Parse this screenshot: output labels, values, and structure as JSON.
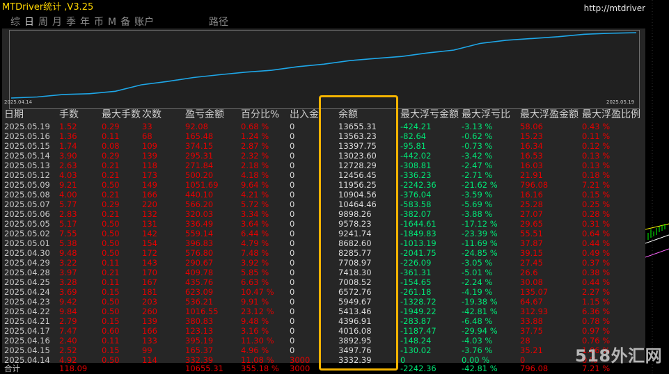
{
  "window": {
    "title": "MTDriver统计 ,V3.25",
    "url": "http://mtdriver.cn"
  },
  "tabs": [
    {
      "label": "综"
    },
    {
      "label": "日"
    },
    {
      "label": "周"
    },
    {
      "label": "月"
    },
    {
      "label": "季"
    },
    {
      "label": "年"
    },
    {
      "label": "币"
    },
    {
      "label": "M"
    },
    {
      "label": "备"
    },
    {
      "label": "账户"
    }
  ],
  "active_tab": 1,
  "path_label": "路径",
  "chart": {
    "type": "line",
    "start_label": "2025.04.14",
    "end_label": "2025.05.19",
    "line_color": "#1ea7e8",
    "series_balance": [
      3332.39,
      3497.76,
      3892.95,
      4016.08,
      4396.91,
      5413.46,
      5949.67,
      6572.76,
      7008.52,
      7418.3,
      7708.97,
      8285.77,
      8682.6,
      9241.74,
      9578.23,
      9898.26,
      10464.46,
      10904.56,
      11956.25,
      12456.45,
      12728.29,
      13023.6,
      13397.75,
      13563.23,
      13655.31
    ]
  },
  "table": {
    "headers": [
      "日期",
      "手数",
      "最大手数",
      "次数",
      "盈亏金额",
      "百分比%",
      "出入金",
      "余额",
      "最大浮亏金额",
      "最大浮亏比",
      "最大浮盈金额",
      "最大浮盈比例"
    ],
    "rows": [
      [
        "2025.05.19",
        "1.52",
        "0.29",
        "33",
        "92.08",
        "0.68 %",
        "0",
        "13655.31",
        "-424.21",
        "-3.13 %",
        "58.06",
        "0.43 %"
      ],
      [
        "2025.05.16",
        "1.36",
        "0.11",
        "68",
        "165.48",
        "1.24 %",
        "0",
        "13563.23",
        "-82.64",
        "-0.62 %",
        "15.23",
        "0.11 %"
      ],
      [
        "2025.05.15",
        "1.74",
        "0.08",
        "109",
        "374.15",
        "2.87 %",
        "0",
        "13397.75",
        "-95.81",
        "-0.73 %",
        "16.34",
        "0.12 %"
      ],
      [
        "2025.05.14",
        "3.90",
        "0.29",
        "139",
        "295.31",
        "2.32 %",
        "0",
        "13023.60",
        "-442.02",
        "-3.42 %",
        "16.53",
        "0.13 %"
      ],
      [
        "2025.05.13",
        "2.63",
        "0.21",
        "118",
        "271.84",
        "2.18 %",
        "0",
        "12728.29",
        "-308.81",
        "-2.47 %",
        "16.03",
        "0.13 %"
      ],
      [
        "2025.05.12",
        "4.03",
        "0.21",
        "173",
        "500.20",
        "4.18 %",
        "0",
        "12456.45",
        "-336.23",
        "-2.71 %",
        "21.91",
        "0.18 %"
      ],
      [
        "2025.05.09",
        "9.21",
        "0.50",
        "149",
        "1051.69",
        "9.64 %",
        "0",
        "11956.25",
        "-2242.36",
        "-21.62 %",
        "796.08",
        "7.21 %"
      ],
      [
        "2025.05.08",
        "4.00",
        "0.21",
        "166",
        "440.10",
        "4.21 %",
        "0",
        "10904.56",
        "-376.04",
        "-3.59 %",
        "16.16",
        "0.15 %"
      ],
      [
        "2025.05.07",
        "5.77",
        "0.29",
        "220",
        "566.20",
        "5.72 %",
        "0",
        "10464.46",
        "-583.58",
        "-5.69 %",
        "25.28",
        "0.25 %"
      ],
      [
        "2025.05.06",
        "2.83",
        "0.21",
        "132",
        "320.03",
        "3.34 %",
        "0",
        "9898.26",
        "-382.07",
        "-3.88 %",
        "27.07",
        "0.28 %"
      ],
      [
        "2025.05.05",
        "5.17",
        "0.50",
        "131",
        "336.49",
        "3.64 %",
        "0",
        "9578.23",
        "-1644.61",
        "-17.12 %",
        "29.65",
        "0.31 %"
      ],
      [
        "2025.05.02",
        "7.55",
        "0.50",
        "142",
        "559.14",
        "6.44 %",
        "0",
        "9241.74",
        "-1849.83",
        "-23.39 %",
        "55.51",
        "0.64 %"
      ],
      [
        "2025.05.01",
        "5.38",
        "0.50",
        "154",
        "396.83",
        "4.79 %",
        "0",
        "8682.60",
        "-1013.19",
        "-11.69 %",
        "37.87",
        "0.44 %"
      ],
      [
        "2025.04.30",
        "9.48",
        "0.50",
        "172",
        "576.80",
        "7.48 %",
        "0",
        "8285.77",
        "-2041.75",
        "-24.85 %",
        "39.15",
        "0.49 %"
      ],
      [
        "2025.04.29",
        "3.22",
        "0.11",
        "143",
        "290.67",
        "3.92 %",
        "0",
        "7708.97",
        "-226.09",
        "-3.05 %",
        "27.45",
        "0.37 %"
      ],
      [
        "2025.04.28",
        "3.97",
        "0.21",
        "170",
        "409.78",
        "5.85 %",
        "0",
        "7418.30",
        "-361.31",
        "-5.01 %",
        "26.6",
        "0.38 %"
      ],
      [
        "2025.04.25",
        "3.28",
        "0.11",
        "167",
        "435.76",
        "6.63 %",
        "0",
        "7008.52",
        "-154.65",
        "-2.24 %",
        "30.08",
        "0.44 %"
      ],
      [
        "2025.04.24",
        "3.69",
        "0.15",
        "181",
        "623.09",
        "10.47 %",
        "0",
        "6572.76",
        "-261.18",
        "-4.19 %",
        "135.07",
        "2.27 %"
      ],
      [
        "2025.04.23",
        "9.42",
        "0.50",
        "203",
        "536.21",
        "9.91 %",
        "0",
        "5949.67",
        "-1328.72",
        "-19.38 %",
        "64.67",
        "1.15 %"
      ],
      [
        "2025.04.22",
        "9.84",
        "0.50",
        "260",
        "1016.55",
        "23.12 %",
        "0",
        "5413.46",
        "-1949.22",
        "-42.81 %",
        "312.93",
        "6.36 %"
      ],
      [
        "2025.04.21",
        "2.79",
        "0.15",
        "139",
        "380.83",
        "9.48 %",
        "0",
        "4396.91",
        "-283.87",
        "-6.48 %",
        "33.88",
        "0.78 %"
      ],
      [
        "2025.04.17",
        "7.47",
        "0.60",
        "166",
        "123.13",
        "3.16 %",
        "0",
        "4016.08",
        "-1187.47",
        "-29.94 %",
        "37.75",
        "0.97 %"
      ],
      [
        "2025.04.16",
        "2.40",
        "0.11",
        "133",
        "395.19",
        "11.30 %",
        "0",
        "3892.95",
        "-148.24",
        "-4.03 %",
        "28",
        "0.76 %"
      ],
      [
        "2025.04.15",
        "2.52",
        "0.15",
        "99",
        "165.37",
        "4.96 %",
        "0",
        "3497.76",
        "-130.02",
        "-3.76 %",
        "35.21",
        "1.06 %"
      ],
      [
        "2025.04.14",
        "4.92",
        "0.50",
        "114",
        "332.39",
        "11.08 %",
        "3000",
        "3332.39",
        "0",
        "0.00 %",
        "0",
        "0 %"
      ]
    ],
    "total": [
      "合计",
      "118.09",
      "",
      "",
      "10655.31",
      "355.18 %",
      "3000",
      "",
      "-2242.36",
      "-42.81 %",
      "796.08",
      "7.21 %"
    ]
  },
  "watermark": "518外汇网"
}
